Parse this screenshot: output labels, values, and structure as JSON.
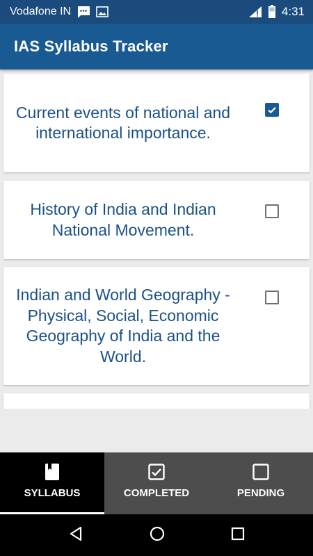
{
  "status_bar": {
    "carrier": "Vodafone IN",
    "time": "4:31"
  },
  "app_bar": {
    "title": "IAS Syllabus Tracker"
  },
  "syllabus_items": [
    {
      "text": "Current events of national and international importance.",
      "checked": true
    },
    {
      "text": "History of India and Indian National Movement.",
      "checked": false
    },
    {
      "text": "Indian and World Geography - Physical, Social, Economic Geography of India and the World.",
      "checked": false
    }
  ],
  "bottom_nav": {
    "tabs": [
      {
        "label": "SYLLABUS",
        "icon": "book-icon",
        "active": true
      },
      {
        "label": "COMPLETED",
        "icon": "checkbox-checked-icon",
        "active": false
      },
      {
        "label": "PENDING",
        "icon": "checkbox-empty-icon",
        "active": false
      }
    ]
  },
  "colors": {
    "status_bar": "#1a4b7c",
    "app_bar": "#1a5a93",
    "item_text": "#1b5187",
    "nav_active": "#000000",
    "nav_inactive": "#4d4d4d"
  }
}
